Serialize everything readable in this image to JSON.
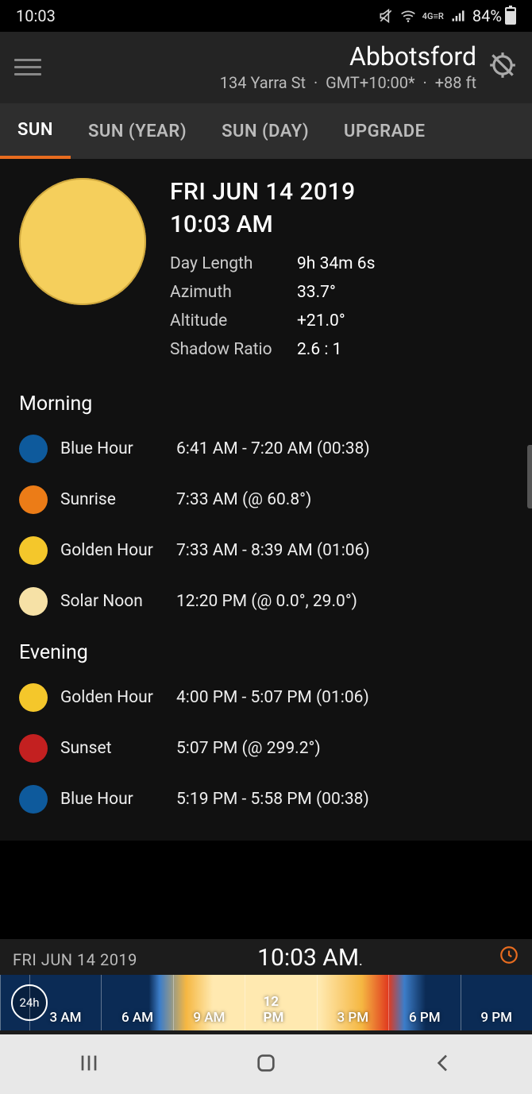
{
  "statusbar": {
    "time": "10:03",
    "network": "4G",
    "battery_pct": "84%"
  },
  "header": {
    "location": "Abbotsford",
    "address": "134 Yarra St",
    "tz": "GMT+10:00*",
    "elevation": "+88 ft"
  },
  "tabs": {
    "sun": "SUN",
    "sun_year": "SUN (YEAR)",
    "sun_day": "SUN (DAY)",
    "upgrade": "UPGRADE"
  },
  "summary": {
    "date": "FRI JUN 14 2019",
    "time": "10:03 AM",
    "stats": [
      {
        "label": "Day Length",
        "value": "9h 34m 6s"
      },
      {
        "label": "Azimuth",
        "value": "33.7°"
      },
      {
        "label": "Altitude",
        "value": "+21.0°"
      },
      {
        "label": "Shadow Ratio",
        "value": "2.6 : 1"
      }
    ]
  },
  "sections": {
    "morning": {
      "title": "Morning",
      "events": [
        {
          "label": "Blue Hour",
          "value": "6:41 AM - 7:20 AM  (00:38)",
          "color": "#0e5a9c"
        },
        {
          "label": "Sunrise",
          "value": "7:33 AM (@ 60.8°)",
          "color": "#ec7c17"
        },
        {
          "label": "Golden Hour",
          "value": "7:33 AM - 8:39 AM  (01:06)",
          "color": "#f4c72b"
        },
        {
          "label": "Solar Noon",
          "value": "12:20 PM (@ 0.0°, 29.0°)",
          "color": "#f6e1a6"
        }
      ]
    },
    "evening": {
      "title": "Evening",
      "events": [
        {
          "label": "Golden Hour",
          "value": "4:00 PM - 5:07 PM  (01:06)",
          "color": "#f4c72b"
        },
        {
          "label": "Sunset",
          "value": "5:07 PM (@ 299.2°)",
          "color": "#c32020"
        },
        {
          "label": "Blue Hour",
          "value": "5:19 PM - 5:58 PM  (00:38)",
          "color": "#0e5a9c"
        }
      ]
    }
  },
  "timeline": {
    "date": "FRI JUN 14 2019",
    "time": "10:03 AM",
    "badge": "24h",
    "ticks": [
      "3 AM",
      "6 AM",
      "9 AM",
      "12 PM",
      "3 PM",
      "6 PM",
      "9 PM"
    ]
  }
}
